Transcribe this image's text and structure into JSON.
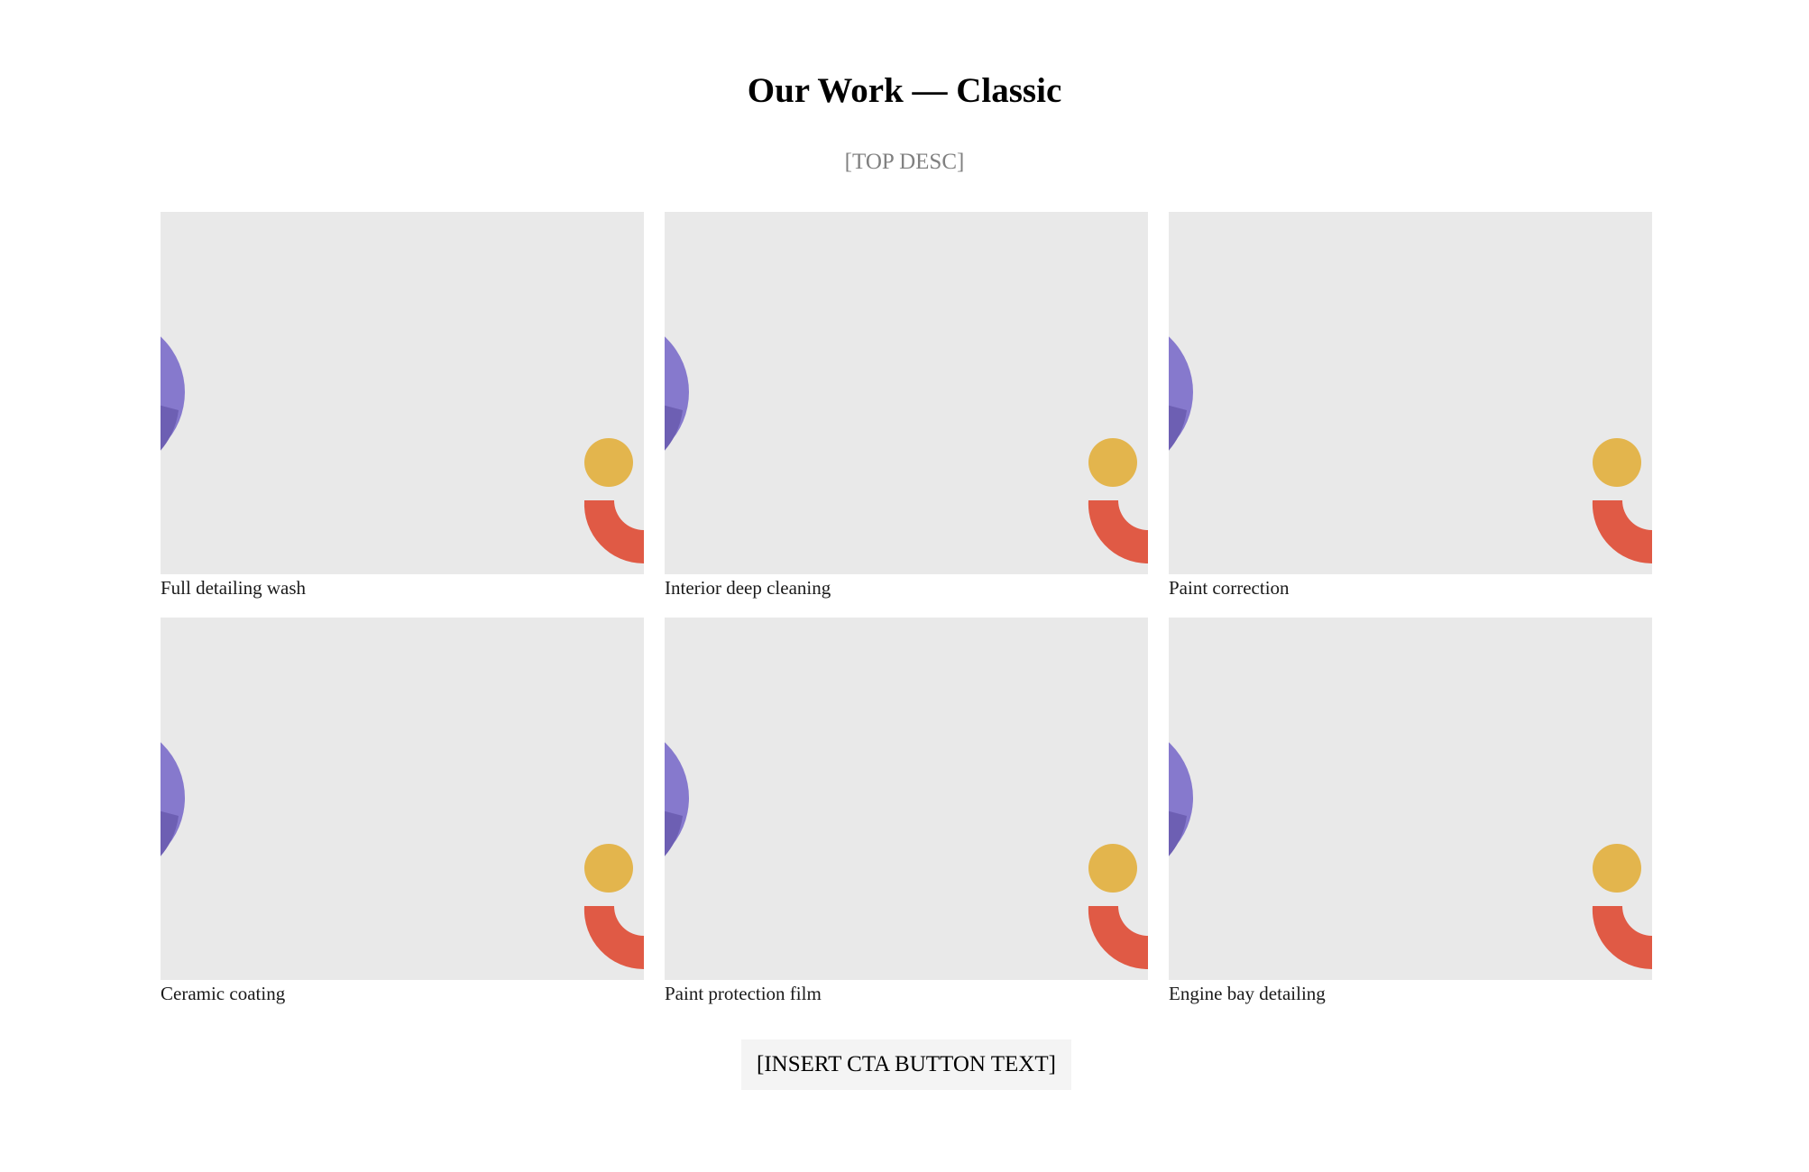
{
  "header": {
    "title": "Our Work — Classic",
    "description": "[TOP DESC]"
  },
  "gallery": {
    "items": [
      {
        "caption": "Full detailing wash"
      },
      {
        "caption": "Interior deep cleaning"
      },
      {
        "caption": "Paint correction"
      },
      {
        "caption": "Ceramic coating"
      },
      {
        "caption": "Paint protection film"
      },
      {
        "caption": "Engine bay detailing"
      }
    ],
    "placeholder_colors": {
      "background": "#e9e9e9",
      "purple": "#8679cd",
      "purple_dark": "#6d5fb3",
      "yellow": "#e3b54d",
      "red": "#e05a45"
    }
  },
  "cta": {
    "label": "[INSERT CTA BUTTON TEXT]"
  }
}
